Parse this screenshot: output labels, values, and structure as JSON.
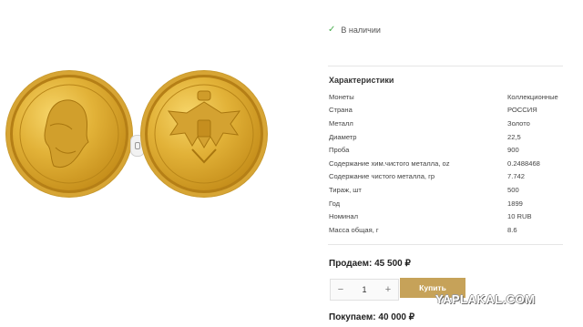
{
  "availability": "В наличии",
  "specs": {
    "title": "Характеристики",
    "rows": [
      {
        "key": "Монеты",
        "value": "Коллекционные"
      },
      {
        "key": "Страна",
        "value": "РОССИЯ"
      },
      {
        "key": "Металл",
        "value": "Золото"
      },
      {
        "key": "Диаметр",
        "value": "22,5"
      },
      {
        "key": "Проба",
        "value": "900"
      },
      {
        "key": "Содержание хим.чистого металла, oz",
        "value": "0.2488468"
      },
      {
        "key": "Содержание чистого металла, гр",
        "value": "7.742"
      },
      {
        "key": "Тираж, шт",
        "value": "500"
      },
      {
        "key": "Год",
        "value": "1899"
      },
      {
        "key": "Номинал",
        "value": "10 RUB"
      },
      {
        "key": "Масса общая, г",
        "value": "8.6"
      }
    ]
  },
  "sell": {
    "label": "Продаем: 45 500 ₽"
  },
  "quantity": {
    "minus": "−",
    "value": "1",
    "plus": "+"
  },
  "buy_button": {
    "label": "Купить"
  },
  "buy_price": {
    "label": "Покупаем: 40 000 ₽"
  },
  "watermark": "YAPLAKAL.COM",
  "icons": {
    "check": "check-icon",
    "zoom": "zoom-handle-icon"
  },
  "colors": {
    "accent": "#c6a259",
    "check": "#4caf50",
    "gold": "#e2b238"
  }
}
